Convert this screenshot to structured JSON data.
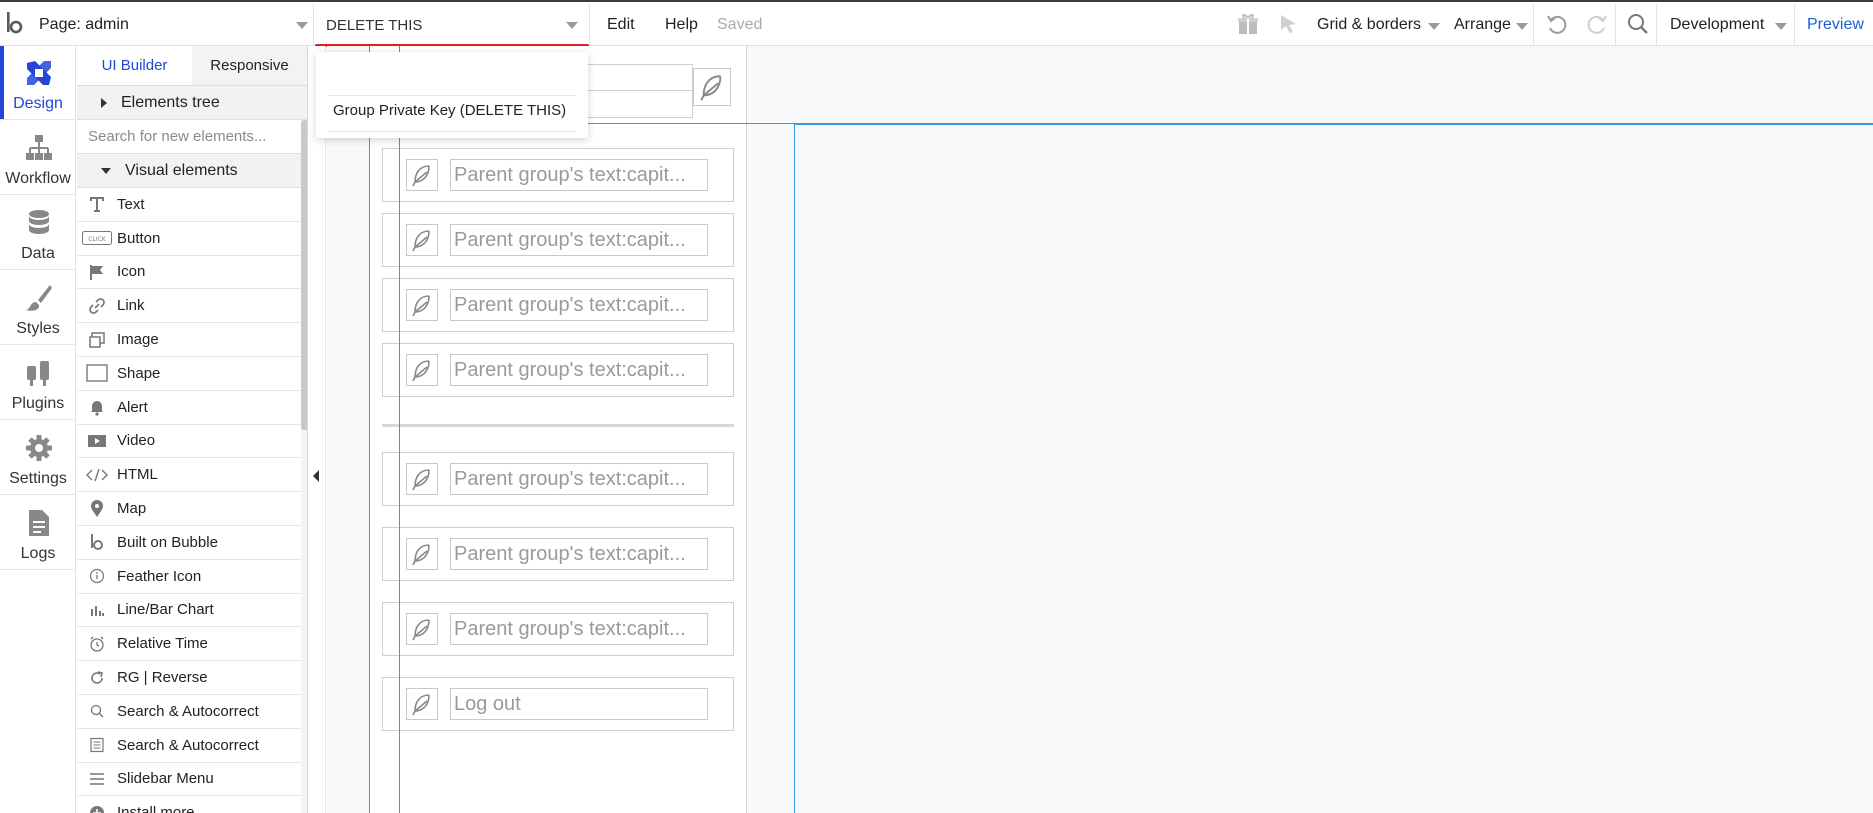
{
  "topbar": {
    "page_label": "Page: admin",
    "element_selected": "DELETE THIS",
    "menu_edit": "Edit",
    "menu_help": "Help",
    "saved_status": "Saved",
    "grid_borders": "Grid & borders",
    "arrange": "Arrange",
    "environment": "Development",
    "preview": "Preview"
  },
  "sidebar": {
    "items": [
      {
        "label": "Design",
        "icon": "design-icon"
      },
      {
        "label": "Workflow",
        "icon": "workflow-icon"
      },
      {
        "label": "Data",
        "icon": "database-icon"
      },
      {
        "label": "Styles",
        "icon": "brush-icon"
      },
      {
        "label": "Plugins",
        "icon": "plug-icon"
      },
      {
        "label": "Settings",
        "icon": "gear-icon"
      },
      {
        "label": "Logs",
        "icon": "document-icon"
      }
    ]
  },
  "panel": {
    "tab_ui_builder": "UI Builder",
    "tab_responsive": "Responsive",
    "elements_tree": "Elements tree",
    "search_placeholder": "Search for new elements...",
    "visual_elements": "Visual elements",
    "elements": [
      {
        "label": "Text",
        "icon": "text-icon"
      },
      {
        "label": "Button",
        "icon": "button-icon"
      },
      {
        "label": "Icon",
        "icon": "flag-icon"
      },
      {
        "label": "Link",
        "icon": "link-icon"
      },
      {
        "label": "Image",
        "icon": "image-icon"
      },
      {
        "label": "Shape",
        "icon": "shape-icon"
      },
      {
        "label": "Alert",
        "icon": "bell-icon"
      },
      {
        "label": "Video",
        "icon": "video-icon"
      },
      {
        "label": "HTML",
        "icon": "code-icon"
      },
      {
        "label": "Map",
        "icon": "map-pin-icon"
      },
      {
        "label": "Built on Bubble",
        "icon": "bubble-logo-icon"
      },
      {
        "label": "Feather Icon",
        "icon": "info-circle-icon"
      },
      {
        "label": "Line/Bar Chart",
        "icon": "bar-chart-icon"
      },
      {
        "label": "Relative Time",
        "icon": "clock-icon"
      },
      {
        "label": "RG | Reverse",
        "icon": "refresh-icon"
      },
      {
        "label": "Search & Autocorrect",
        "icon": "search-icon"
      },
      {
        "label": "Search & Autocorrect",
        "icon": "list-icon"
      },
      {
        "label": "Slidebar Menu",
        "icon": "menu-icon"
      },
      {
        "label": "Install more...",
        "icon": "plus-circle-icon"
      }
    ]
  },
  "dropdown": {
    "option": "Group Private Key (DELETE THIS)"
  },
  "canvas": {
    "nav_rows": [
      "Parent group's text:capit...",
      "Parent group's text:capit...",
      "Parent group's text:capit...",
      "Parent group's text:capit...",
      "Parent group's text:capit...",
      "Parent group's text:capit...",
      "Parent group's text:capit...",
      "Log out"
    ]
  }
}
